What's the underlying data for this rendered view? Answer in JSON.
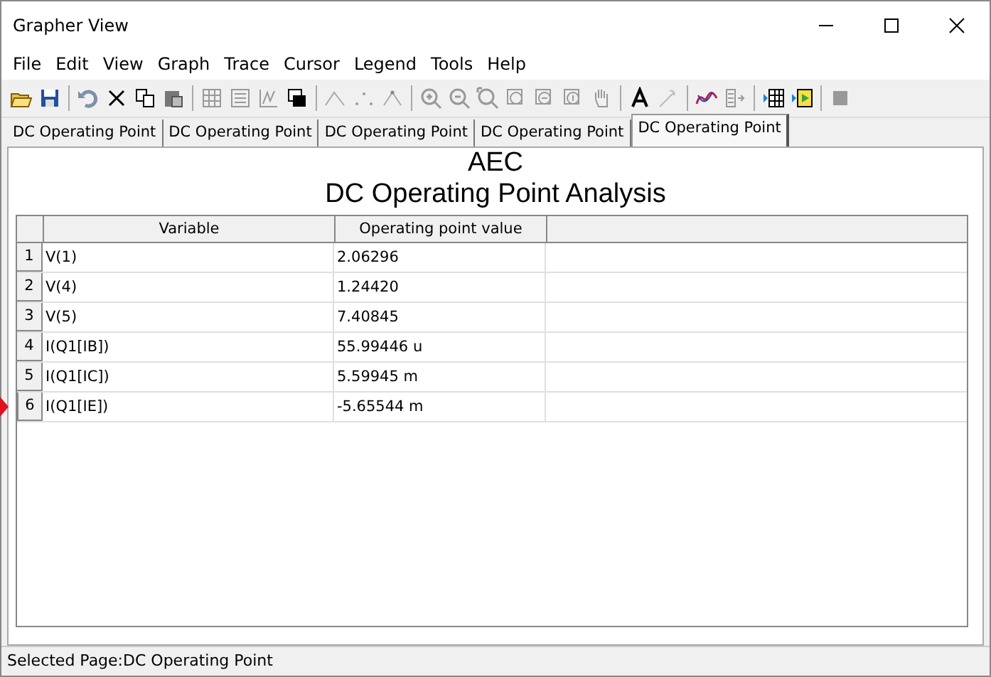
{
  "window": {
    "title": "Grapher View"
  },
  "menu": [
    "File",
    "Edit",
    "View",
    "Graph",
    "Trace",
    "Cursor",
    "Legend",
    "Tools",
    "Help"
  ],
  "tabs": [
    {
      "label": "DC Operating Point",
      "selected": false
    },
    {
      "label": "DC Operating Point",
      "selected": false
    },
    {
      "label": "DC Operating Point",
      "selected": false
    },
    {
      "label": "DC Operating Point",
      "selected": false
    },
    {
      "label": "DC Operating Point",
      "selected": true
    }
  ],
  "page": {
    "title": "AEC",
    "subtitle": "DC Operating Point Analysis"
  },
  "table": {
    "columns": [
      "Variable",
      "Operating point value"
    ],
    "rows": [
      {
        "index": "1",
        "cells": [
          "V(1)",
          "2.06296"
        ],
        "selected": false
      },
      {
        "index": "2",
        "cells": [
          "V(4)",
          "1.24420"
        ],
        "selected": false
      },
      {
        "index": "3",
        "cells": [
          "V(5)",
          "7.40845"
        ],
        "selected": false
      },
      {
        "index": "4",
        "cells": [
          "I(Q1[IB])",
          "55.99446 u"
        ],
        "selected": false
      },
      {
        "index": "5",
        "cells": [
          "I(Q1[IC])",
          "5.59945 m"
        ],
        "selected": false
      },
      {
        "index": "6",
        "cells": [
          "I(Q1[IE])",
          "-5.65544 m"
        ],
        "selected": true
      }
    ]
  },
  "status_bar": "Selected Page:DC Operating Point"
}
